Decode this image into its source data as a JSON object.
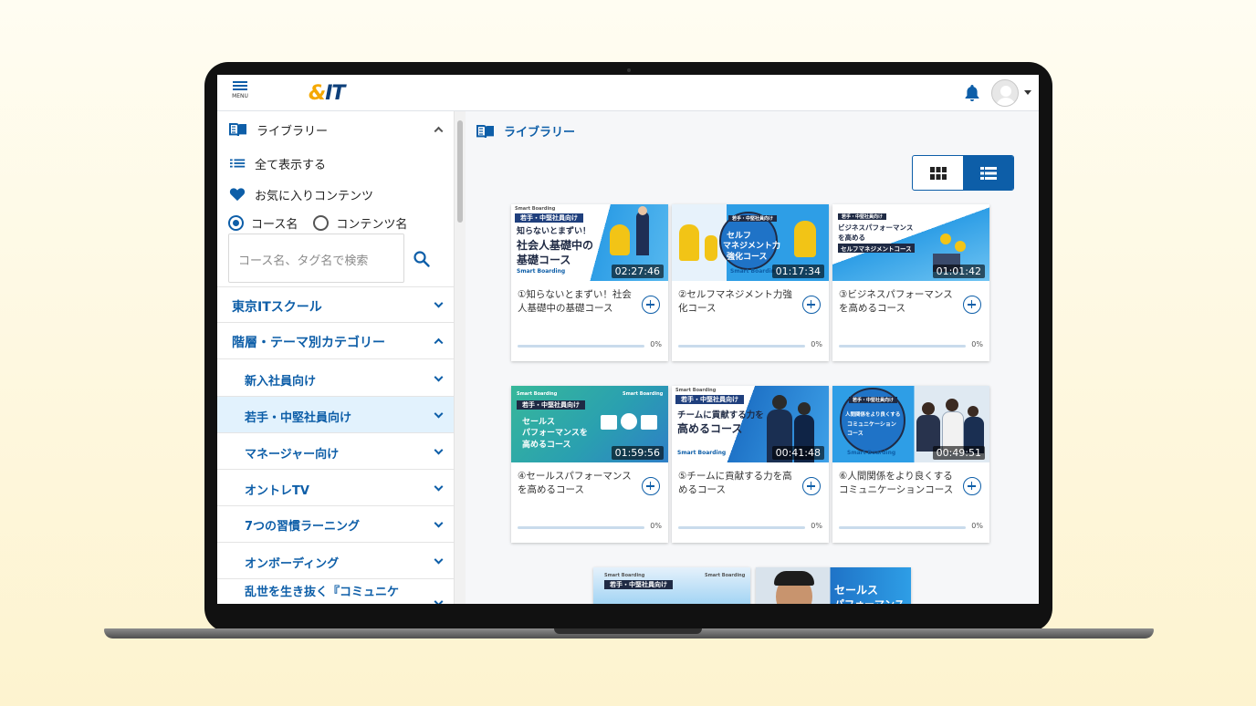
{
  "header": {
    "menu_label": "MENU",
    "logo_amp": "&",
    "logo_it": "IT"
  },
  "sidebar": {
    "library_label": "ライブラリー",
    "show_all_label": "全て表示する",
    "favorites_label": "お気に入りコンテンツ",
    "radio_course": "コース名",
    "radio_content": "コンテンツ名",
    "search_placeholder": "コース名、タグ名で検索",
    "categories": [
      {
        "label": "東京ITスクール"
      },
      {
        "label": "階層・テーマ別カテゴリー"
      }
    ],
    "subcategories": [
      {
        "label": "新入社員向け"
      },
      {
        "label": "若手・中堅社員向け"
      },
      {
        "label": "マネージャー向け"
      },
      {
        "label": "オントレTV"
      },
      {
        "label": "7つの習慣ラーニング"
      },
      {
        "label": "オンボーディング"
      },
      {
        "label": "乱世を生き抜く『コミュニケ"
      }
    ]
  },
  "main": {
    "title": "ライブラリー",
    "cards": [
      {
        "title": "①知らないとまずい！社会人基礎中の基礎コース",
        "duration": "02:27:46",
        "progress": 0,
        "progress_label": "0%",
        "thumb_tag": "若手・中堅社員向け",
        "thumb_l1": "知らないとまずい！",
        "thumb_l2": "社会人基礎中の",
        "thumb_l3": "基礎コース",
        "brand": "Smart Boarding"
      },
      {
        "title": "②セルフマネジメント力強化コース",
        "duration": "01:17:34",
        "progress": 0,
        "progress_label": "0%",
        "thumb_tag": "若手・中堅社員向け",
        "thumb_l1": "セルフ",
        "thumb_l2": "マネジメント力",
        "thumb_l3": "強化コース",
        "brand": "Smart Boarding"
      },
      {
        "title": "③ビジネスパフォーマンスを高めるコース",
        "duration": "01:01:42",
        "progress": 0,
        "progress_label": "0%",
        "thumb_tag": "若手・中堅社員向け",
        "thumb_l1": "ビジネスパフォーマンス",
        "thumb_l2": "を高める",
        "thumb_l3": "セルフマネジメントコース"
      },
      {
        "title": "④セールスパフォーマンスを高めるコース",
        "duration": "01:59:56",
        "progress": 0,
        "progress_label": "0%",
        "thumb_tag": "若手・中堅社員向け",
        "thumb_l1": "セールス",
        "thumb_l2": "パフォーマンスを",
        "thumb_l3": "高めるコース",
        "brand": "Smart Boarding"
      },
      {
        "title": "⑤チームに貢献する力を高めるコース",
        "duration": "00:41:48",
        "progress": 0,
        "progress_label": "0%",
        "thumb_tag": "若手・中堅社員向け",
        "thumb_l1": "チームに貢献する力を",
        "thumb_l2": "高めるコース",
        "brand": "Smart Boarding"
      },
      {
        "title": "⑥人間関係をより良くするコミュニケーションコース",
        "duration": "00:49:51",
        "progress": 0,
        "progress_label": "0%",
        "thumb_tag": "若手・中堅社員向け",
        "thumb_l1": "人間関係をより良くする",
        "thumb_l2": "コミュニケーション",
        "thumb_l3": "コース",
        "brand": "Smart Boarding"
      }
    ],
    "partial_cards": [
      {
        "thumb_tag": "若手・中堅社員向け",
        "brand": "Smart Boarding"
      },
      {
        "thumb_l1": "セールス",
        "thumb_l2": "パフォーマンス"
      }
    ]
  },
  "colors": {
    "accent": "#0d5ea8",
    "selected_row": "#e2f2fd",
    "logo_amp": "#f5a800",
    "logo_it": "#0d3f7a"
  }
}
